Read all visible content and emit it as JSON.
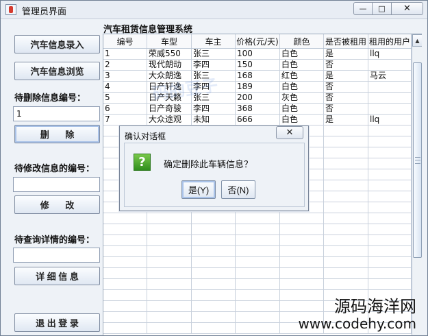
{
  "window": {
    "title": "管理员界面",
    "minimize_icon": "minimize-icon",
    "maximize_icon": "maximize-icon",
    "close_icon": "close-icon"
  },
  "sidebar": {
    "entry_button": "汽车信息录入",
    "browse_button": "汽车信息浏览",
    "delete_label": "待删除信息编号：",
    "delete_value": "1",
    "delete_button": "删 除",
    "modify_label": "待修改信息的编号：",
    "modify_value": "",
    "modify_button": "修 改",
    "detail_label": "待查询详情的编号：",
    "detail_value": "",
    "detail_button": "详 细 信 息",
    "logout_button": "退 出 登 录"
  },
  "main": {
    "system_title": "汽车租赁信息管理系统",
    "watermark": "码的豆子"
  },
  "table": {
    "headers": [
      "编号",
      "车型",
      "车主",
      "价格(元/天)",
      "颜色",
      "是否被租用",
      "租用的用户"
    ],
    "rows": [
      [
        "1",
        "荣威550",
        "张三",
        "100",
        "白色",
        "是",
        "llq"
      ],
      [
        "2",
        "现代朗动",
        "李四",
        "150",
        "白色",
        "否",
        ""
      ],
      [
        "3",
        "大众朗逸",
        "张三",
        "168",
        "红色",
        "是",
        "马云"
      ],
      [
        "4",
        "日产轩逸",
        "李四",
        "189",
        "白色",
        "否",
        ""
      ],
      [
        "5",
        "日产天籁",
        "张三",
        "200",
        "灰色",
        "否",
        ""
      ],
      [
        "6",
        "日产奇骏",
        "李四",
        "368",
        "白色",
        "否",
        ""
      ],
      [
        "7",
        "大众途观",
        "未知",
        "666",
        "白色",
        "是",
        "llq"
      ]
    ]
  },
  "dialog": {
    "title": "确认对话框",
    "close_icon": "close-icon",
    "question_icon": "question-icon",
    "message": "确定删除此车辆信息？",
    "yes_button": "是(Y)",
    "no_button": "否(N)"
  },
  "brand": {
    "name": "源码海洋网",
    "url": "www.codehy.com"
  },
  "colors": {
    "window_background": "#eef2f7",
    "table_border": "#c8d0dc",
    "question_icon": "#3f9d28"
  }
}
